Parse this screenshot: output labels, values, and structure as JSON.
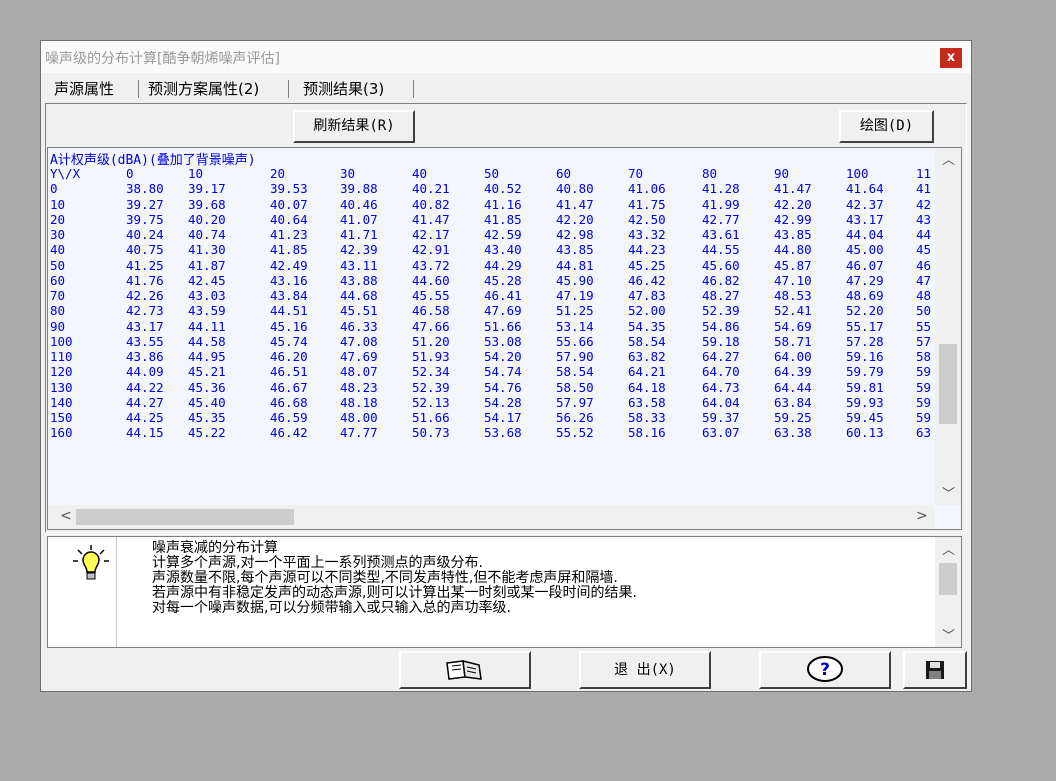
{
  "window": {
    "title": "噪声级的分布计算[酷争朝烯噪声评估]",
    "close_label": "x"
  },
  "tabs": [
    {
      "label": "声源属性"
    },
    {
      "label": "预测方案属性(2)"
    },
    {
      "label": "预测结果(3)"
    }
  ],
  "toolbar": {
    "refresh_label": "刷新结果(R)",
    "plot_label": "绘图(D)"
  },
  "results": {
    "heading": "A计权声级(dBA)(叠加了背景噪声)",
    "corner_label": "Y\\/X",
    "x_headers": [
      "0",
      "10",
      "20",
      "30",
      "40",
      "50",
      "60",
      "70",
      "80",
      "90",
      "100",
      "11"
    ],
    "rows": [
      {
        "y": "0",
        "v": [
          "38.80",
          "39.17",
          "39.53",
          "39.88",
          "40.21",
          "40.52",
          "40.80",
          "41.06",
          "41.28",
          "41.47",
          "41.64",
          "41"
        ]
      },
      {
        "y": "10",
        "v": [
          "39.27",
          "39.68",
          "40.07",
          "40.46",
          "40.82",
          "41.16",
          "41.47",
          "41.75",
          "41.99",
          "42.20",
          "42.37",
          "42"
        ]
      },
      {
        "y": "20",
        "v": [
          "39.75",
          "40.20",
          "40.64",
          "41.07",
          "41.47",
          "41.85",
          "42.20",
          "42.50",
          "42.77",
          "42.99",
          "43.17",
          "43"
        ]
      },
      {
        "y": "30",
        "v": [
          "40.24",
          "40.74",
          "41.23",
          "41.71",
          "42.17",
          "42.59",
          "42.98",
          "43.32",
          "43.61",
          "43.85",
          "44.04",
          "44"
        ]
      },
      {
        "y": "40",
        "v": [
          "40.75",
          "41.30",
          "41.85",
          "42.39",
          "42.91",
          "43.40",
          "43.85",
          "44.23",
          "44.55",
          "44.80",
          "45.00",
          "45"
        ]
      },
      {
        "y": "50",
        "v": [
          "41.25",
          "41.87",
          "42.49",
          "43.11",
          "43.72",
          "44.29",
          "44.81",
          "45.25",
          "45.60",
          "45.87",
          "46.07",
          "46"
        ]
      },
      {
        "y": "60",
        "v": [
          "41.76",
          "42.45",
          "43.16",
          "43.88",
          "44.60",
          "45.28",
          "45.90",
          "46.42",
          "46.82",
          "47.10",
          "47.29",
          "47"
        ]
      },
      {
        "y": "70",
        "v": [
          "42.26",
          "43.03",
          "43.84",
          "44.68",
          "45.55",
          "46.41",
          "47.19",
          "47.83",
          "48.27",
          "48.53",
          "48.69",
          "48"
        ]
      },
      {
        "y": "80",
        "v": [
          "42.73",
          "43.59",
          "44.51",
          "45.51",
          "46.58",
          "47.69",
          "51.25",
          "52.00",
          "52.39",
          "52.41",
          "52.20",
          "50"
        ]
      },
      {
        "y": "90",
        "v": [
          "43.17",
          "44.11",
          "45.16",
          "46.33",
          "47.66",
          "51.66",
          "53.14",
          "54.35",
          "54.86",
          "54.69",
          "55.17",
          "55"
        ]
      },
      {
        "y": "100",
        "v": [
          "43.55",
          "44.58",
          "45.74",
          "47.08",
          "51.20",
          "53.08",
          "55.66",
          "58.54",
          "59.18",
          "58.71",
          "57.28",
          "57"
        ]
      },
      {
        "y": "110",
        "v": [
          "43.86",
          "44.95",
          "46.20",
          "47.69",
          "51.93",
          "54.20",
          "57.90",
          "63.82",
          "64.27",
          "64.00",
          "59.16",
          "58"
        ]
      },
      {
        "y": "120",
        "v": [
          "44.09",
          "45.21",
          "46.51",
          "48.07",
          "52.34",
          "54.74",
          "58.54",
          "64.21",
          "64.70",
          "64.39",
          "59.79",
          "59"
        ]
      },
      {
        "y": "130",
        "v": [
          "44.22",
          "45.36",
          "46.67",
          "48.23",
          "52.39",
          "54.76",
          "58.50",
          "64.18",
          "64.73",
          "64.44",
          "59.81",
          "59"
        ]
      },
      {
        "y": "140",
        "v": [
          "44.27",
          "45.40",
          "46.68",
          "48.18",
          "52.13",
          "54.28",
          "57.97",
          "63.58",
          "64.04",
          "63.84",
          "59.93",
          "59"
        ]
      },
      {
        "y": "150",
        "v": [
          "44.25",
          "45.35",
          "46.59",
          "48.00",
          "51.66",
          "54.17",
          "56.26",
          "58.33",
          "59.37",
          "59.25",
          "59.45",
          "59"
        ]
      },
      {
        "y": "160",
        "v": [
          "44.15",
          "45.22",
          "46.42",
          "47.77",
          "50.73",
          "53.68",
          "55.52",
          "58.16",
          "63.07",
          "63.38",
          "60.13",
          "63"
        ]
      }
    ]
  },
  "help": {
    "lines": [
      "噪声衰减的分布计算",
      "计算多个声源,对一个平面上一系列预测点的声级分布.",
      "声源数量不限,每个声源可以不同类型,不同发声特性,但不能考虑声屏和隔墙.",
      "若声源中有非稳定发声的动态声源,则可以计算出某一时刻或某一段时间的结果.",
      "对每一个噪声数据,可以分频带输入或只输入总的声功率级."
    ]
  },
  "footer": {
    "exit_label": "退 出(X)",
    "book_icon": "book-icon",
    "help_icon": "help-icon",
    "save_icon": "floppy-disk-icon"
  },
  "colors": {
    "data_text": "#0000e0",
    "close_button": "#c42b1c",
    "list_background": "#f4f6fe"
  }
}
